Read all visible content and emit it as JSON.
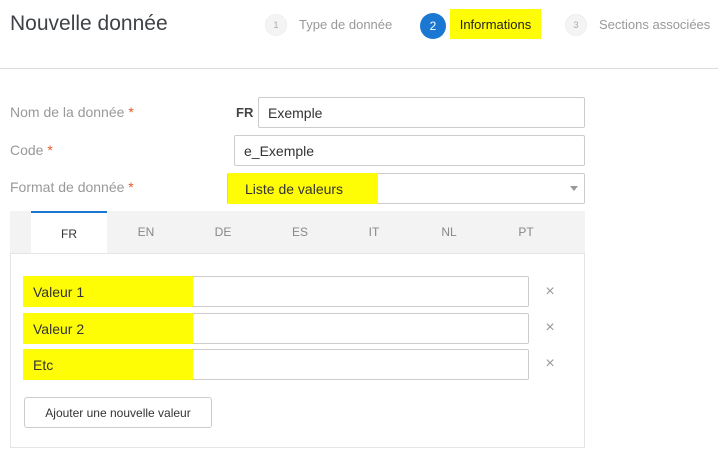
{
  "header": {
    "title": "Nouvelle donnée",
    "steps": [
      {
        "number": "1",
        "label": "Type de donnée"
      },
      {
        "number": "2",
        "label": "Informations"
      },
      {
        "number": "3",
        "label": "Sections associées"
      }
    ],
    "active_step": 2
  },
  "form": {
    "name_label": "Nom de la donnée",
    "name_lang": "FR",
    "name_value": "Exemple",
    "code_label": "Code",
    "code_value": "e_Exemple",
    "format_label": "Format de donnée",
    "format_value": "Liste de valeurs",
    "required_mark": "*"
  },
  "tabs": [
    "FR",
    "EN",
    "DE",
    "ES",
    "IT",
    "NL",
    "PT"
  ],
  "active_tab": "FR",
  "values": [
    "Valeur 1",
    "Valeur 2",
    "Etc"
  ],
  "add_button_label": "Ajouter une nouvelle valeur",
  "remove_glyph": "×",
  "colors": {
    "accent": "#1a78d2",
    "highlight": "#fffd06",
    "required": "#e15b2b"
  }
}
